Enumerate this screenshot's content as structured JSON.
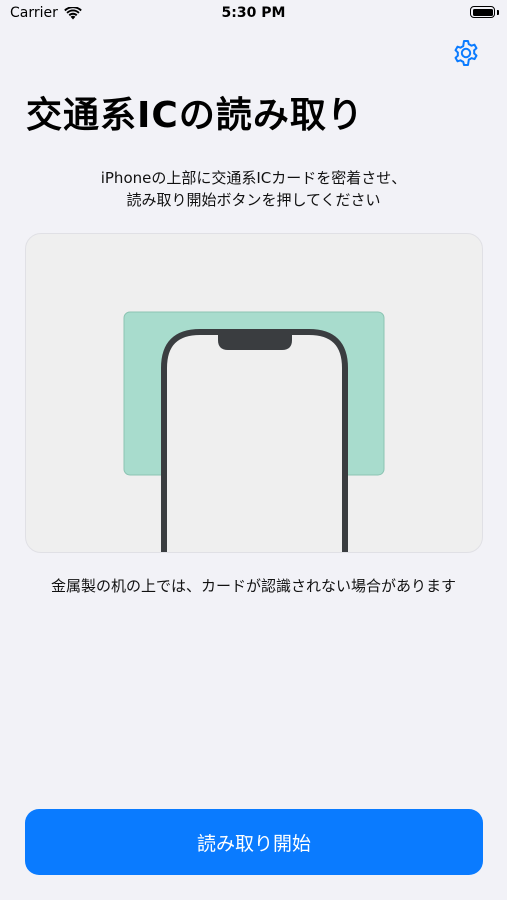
{
  "status_bar": {
    "carrier": "Carrier",
    "time": "5:30 PM",
    "battery_level": 1.0
  },
  "header": {
    "settings_icon": "gear-icon",
    "title": "交通系ICの読み取り"
  },
  "instruction": {
    "line1": "iPhoneの上部に交通系ICカードを密着させ、",
    "line2": "読み取り開始ボタンを押してください"
  },
  "illustration": {
    "card_color": "#a8dccd",
    "phone_frame_color": "#3a3d40"
  },
  "note": "金属製の机の上では、カードが認識されない場合があります",
  "start_button": {
    "label": "読み取り開始",
    "color": "#0a7bff"
  }
}
